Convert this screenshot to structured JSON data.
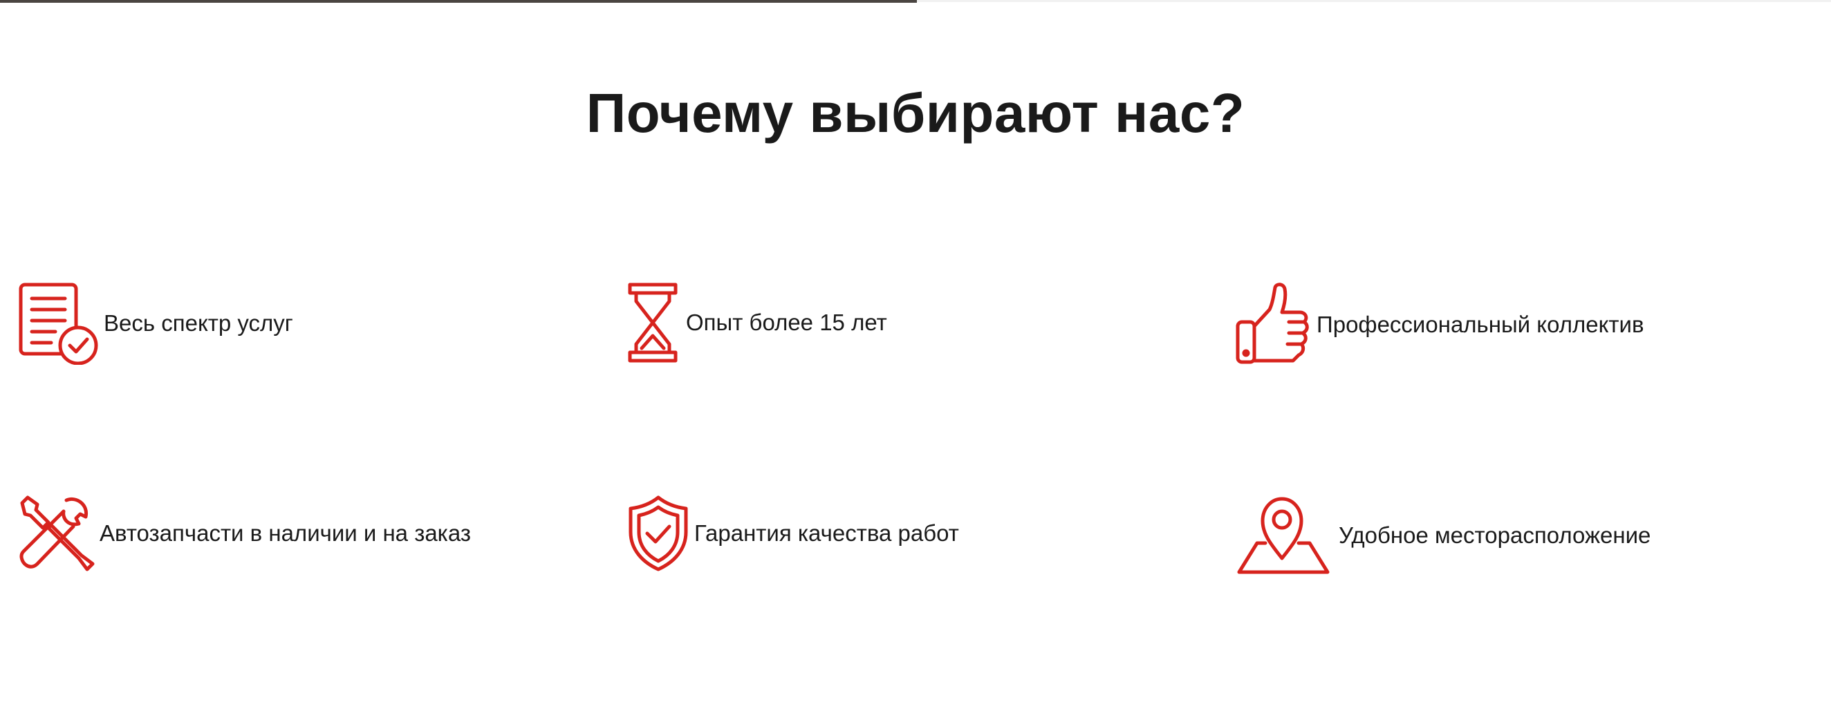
{
  "section": {
    "title": "Почему выбирают нас?"
  },
  "accent_color": "#d7231d",
  "features": [
    {
      "icon": "checklist-icon",
      "label": "Весь спектр услуг"
    },
    {
      "icon": "hourglass-icon",
      "label": "Опыт более 15 лет"
    },
    {
      "icon": "thumbs-up-icon",
      "label": "Профессиональный коллектив"
    },
    {
      "icon": "tools-icon",
      "label": "Автозапчасти в наличии и на заказ"
    },
    {
      "icon": "shield-check-icon",
      "label": "Гарантия качества работ"
    },
    {
      "icon": "map-pin-icon",
      "label": "Удобное месторасположение"
    }
  ]
}
